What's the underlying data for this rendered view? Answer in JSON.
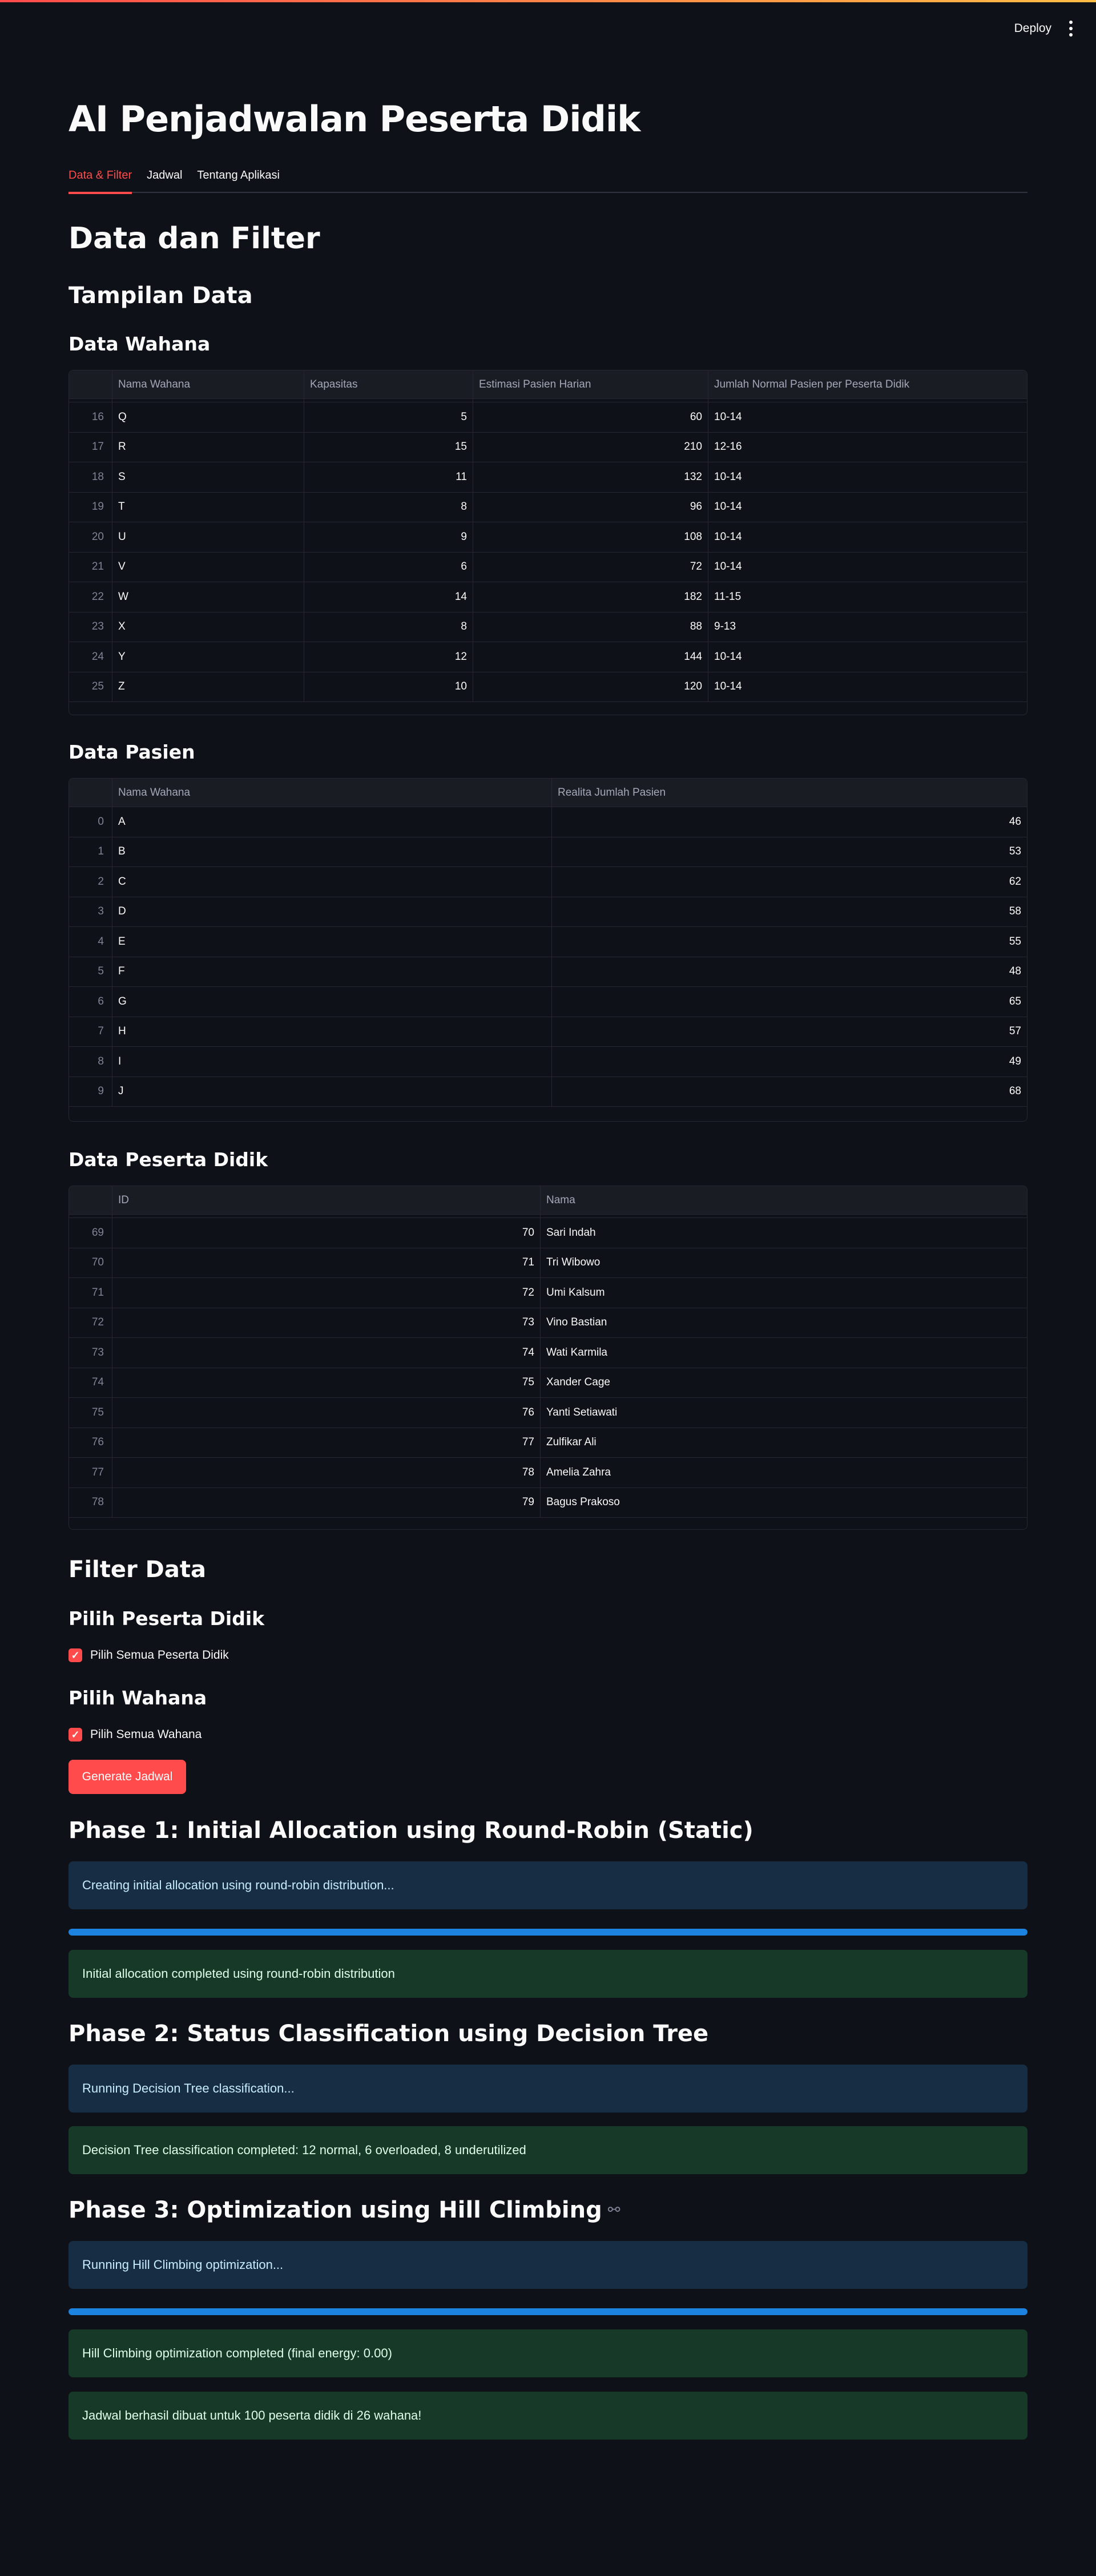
{
  "header": {
    "deploy_label": "Deploy",
    "menu_icon": "more-vertical-icon"
  },
  "app_title": "AI Penjadwalan Peserta Didik",
  "tabs": [
    {
      "label": "Data & Filter",
      "active": true
    },
    {
      "label": "Jadwal",
      "active": false
    },
    {
      "label": "Tentang Aplikasi",
      "active": false
    }
  ],
  "sections": {
    "data_filter": "Data dan Filter",
    "tampilan": "Tampilan Data",
    "wahana": "Data Wahana",
    "pasien": "Data Pasien",
    "peserta": "Data Peserta Didik",
    "filter": "Filter Data",
    "pilih_peserta": "Pilih Peserta Didik",
    "pilih_wahana": "Pilih Wahana"
  },
  "wahana_table": {
    "columns": [
      "",
      "Nama Wahana",
      "Kapasitas",
      "Estimasi Pasien Harian",
      "Jumlah Normal Pasien per Peserta Didik"
    ],
    "rows": [
      [
        "16",
        "Q",
        "5",
        "60",
        "10-14"
      ],
      [
        "17",
        "R",
        "15",
        "210",
        "12-16"
      ],
      [
        "18",
        "S",
        "11",
        "132",
        "10-14"
      ],
      [
        "19",
        "T",
        "8",
        "96",
        "10-14"
      ],
      [
        "20",
        "U",
        "9",
        "108",
        "10-14"
      ],
      [
        "21",
        "V",
        "6",
        "72",
        "10-14"
      ],
      [
        "22",
        "W",
        "14",
        "182",
        "11-15"
      ],
      [
        "23",
        "X",
        "8",
        "88",
        "9-13"
      ],
      [
        "24",
        "Y",
        "12",
        "144",
        "10-14"
      ],
      [
        "25",
        "Z",
        "10",
        "120",
        "10-14"
      ]
    ]
  },
  "pasien_table": {
    "columns": [
      "",
      "Nama Wahana",
      "Realita Jumlah Pasien"
    ],
    "rows": [
      [
        "0",
        "A",
        "46"
      ],
      [
        "1",
        "B",
        "53"
      ],
      [
        "2",
        "C",
        "62"
      ],
      [
        "3",
        "D",
        "58"
      ],
      [
        "4",
        "E",
        "55"
      ],
      [
        "5",
        "F",
        "48"
      ],
      [
        "6",
        "G",
        "65"
      ],
      [
        "7",
        "H",
        "57"
      ],
      [
        "8",
        "I",
        "49"
      ],
      [
        "9",
        "J",
        "68"
      ]
    ]
  },
  "peserta_table": {
    "columns": [
      "",
      "ID",
      "Nama"
    ],
    "rows": [
      [
        "69",
        "70",
        "Sari Indah"
      ],
      [
        "70",
        "71",
        "Tri Wibowo"
      ],
      [
        "71",
        "72",
        "Umi Kalsum"
      ],
      [
        "72",
        "73",
        "Vino Bastian"
      ],
      [
        "73",
        "74",
        "Wati Karmila"
      ],
      [
        "74",
        "75",
        "Xander Cage"
      ],
      [
        "75",
        "76",
        "Yanti Setiawati"
      ],
      [
        "76",
        "77",
        "Zulfikar Ali"
      ],
      [
        "77",
        "78",
        "Amelia Zahra"
      ],
      [
        "78",
        "79",
        "Bagus Prakoso"
      ]
    ]
  },
  "filters": {
    "all_peserta_label": "Pilih Semua Peserta Didik",
    "all_wahana_label": "Pilih Semua Wahana",
    "generate_label": "Generate Jadwal"
  },
  "phases": {
    "p1_title": "Phase 1: Initial Allocation using Round-Robin (Static)",
    "p1_info": "Creating initial allocation using round-robin distribution...",
    "p1_progress": 1.0,
    "p1_success": "Initial allocation completed using round-robin distribution",
    "p2_title": "Phase 2: Status Classification using Decision Tree",
    "p2_info": "Running Decision Tree classification...",
    "p2_success": "Decision Tree classification completed: 12 normal, 6 overloaded, 8 underutilized",
    "p3_title": "Phase 3: Optimization using Hill Climbing",
    "p3_info": "Running Hill Climbing optimization...",
    "p3_progress": 1.0,
    "p3_success": "Hill Climbing optimization completed (final energy: 0.00)",
    "final_success": "Jadwal berhasil dibuat untuk 100 peserta didik di 26 wahana!"
  },
  "colors": {
    "accent": "#ff4b4b",
    "background": "#0e1117",
    "info_bg": "#172d43",
    "success_bg": "#173928",
    "progress": "#1c83e1"
  }
}
